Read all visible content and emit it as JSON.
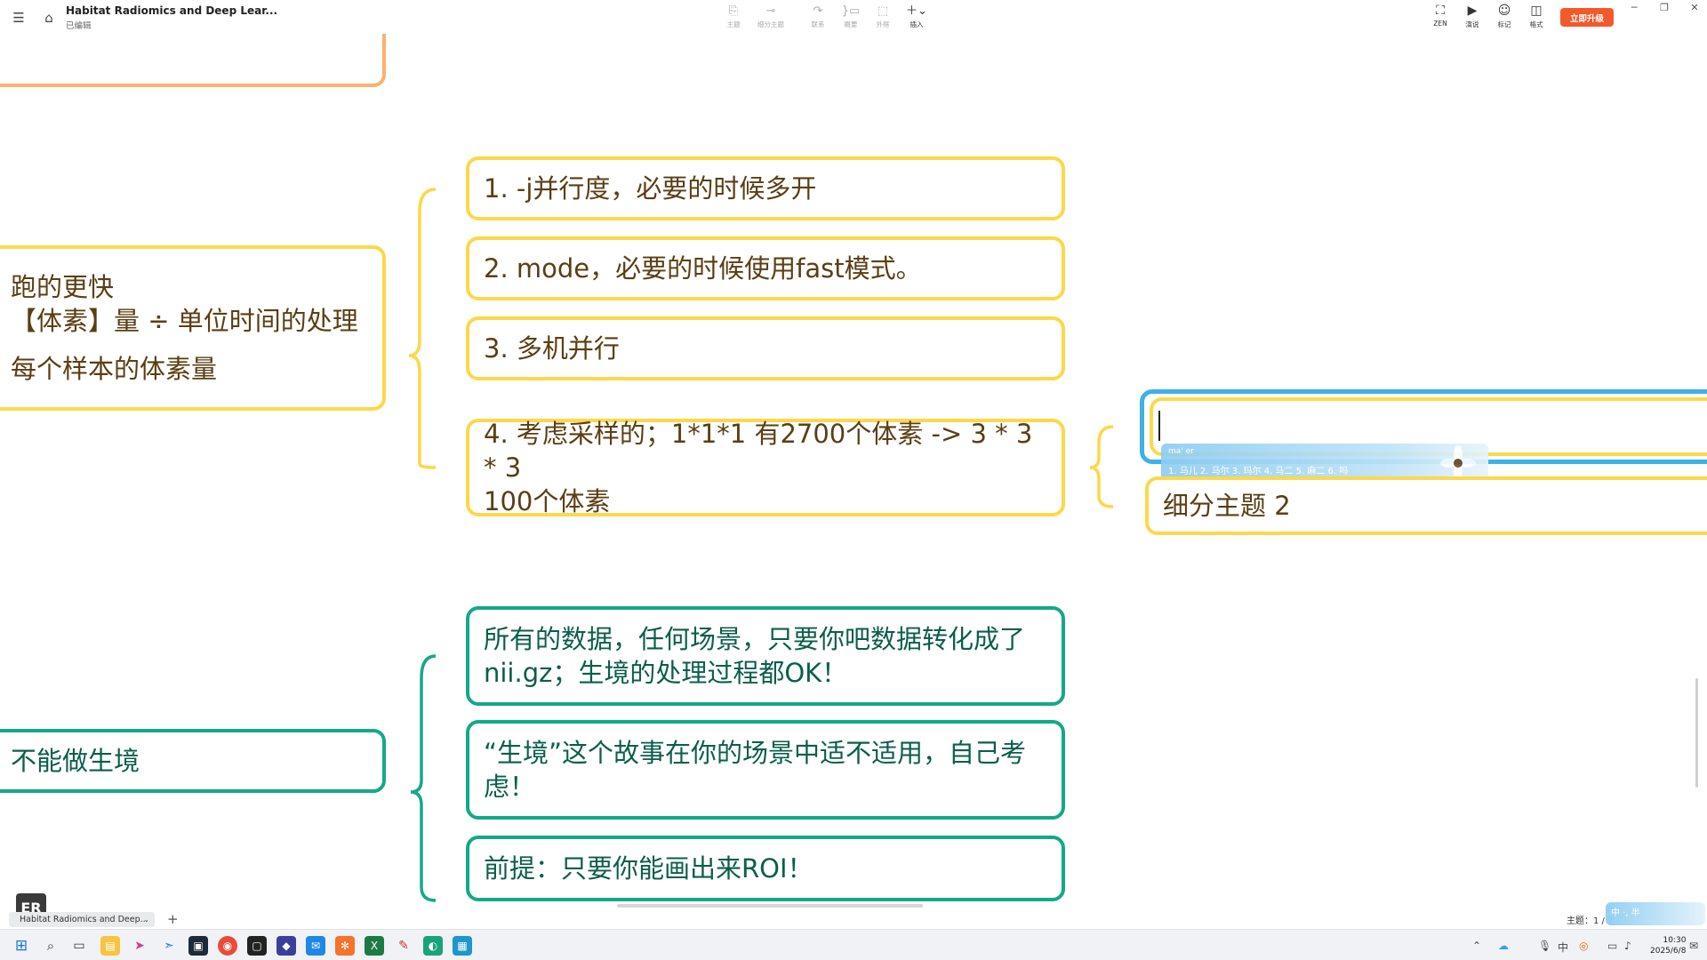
{
  "app": {
    "doc_title": "Habitat Radiomics and Deep Lear...",
    "doc_status": "已编辑"
  },
  "toolbar": {
    "topic": "主题",
    "subtopic": "细分主题",
    "relation": "联系",
    "summary": "概要",
    "boundary": "外框",
    "insert": "插入"
  },
  "right_toolbar": {
    "zen": "ZEN",
    "present": "演说",
    "marker": "标记",
    "format": "格式",
    "upgrade": "立即升级"
  },
  "nodes": {
    "left_orange_partial": "",
    "left_yellow_line1": "跑的更快",
    "left_yellow_line2": "【体素】量 ÷ 单位时间的处理",
    "left_yellow_line3": "每个样本的体素量",
    "left_green": "不能做生境",
    "y1": "1. -j并行度，必要的时候多开",
    "y2": "2. mode，必要的时候使用fast模式。",
    "y3": "3. 多机并行",
    "y4_line1": "4. 考虑采样的；1*1*1 有2700个体素 -> 3 * 3 * 3",
    "y4_line2": "100个体素",
    "sub_editing": "",
    "sub2": "细分主题 2",
    "g1_line1": "所有的数据，任何场景，只要你吧数据转化成了",
    "g1_line2": "nii.gz；生境的处理过程都OK！",
    "g2_line1": "“生境”这个故事在你的场景中适不适用，自己考",
    "g2_line2": "虑！",
    "g3": "前提：只要你能画出来ROI！"
  },
  "ime": {
    "composition": "ma' er",
    "candidates": "1. 马儿  2. 马尔  3. 玛尔  4. 马二  5. 麻二  6. 吗"
  },
  "bottom": {
    "er_badge": "ER",
    "sheet_tab": "Habitat Radiomics and Deep...",
    "add": "+",
    "topic_count": "主题：1 / 7",
    "ime_status": "中 ·, 半"
  },
  "taskbar": {
    "time": "10:30",
    "date": "2025/6/8"
  },
  "colors": {
    "yellow_border": "#fcd84a",
    "green_border": "#14a88a",
    "orange_border": "#f7b36d",
    "blue_selection": "#3fb0e8",
    "upgrade_button": "#f25a2b"
  }
}
